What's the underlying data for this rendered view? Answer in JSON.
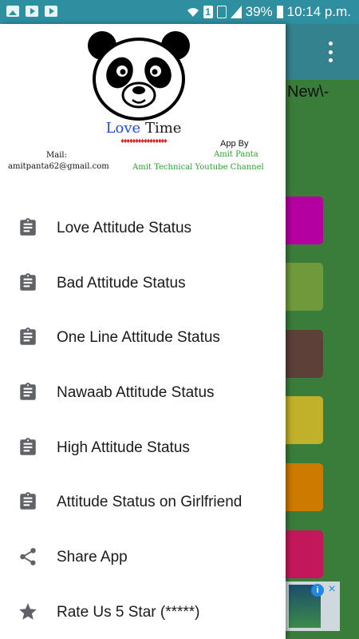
{
  "status_bar": {
    "battery": "39%",
    "sim": "1",
    "time": "10:14 p.m.",
    "icons": [
      "image-icon",
      "video-icon",
      "video-icon",
      "wifi-icon",
      "sim-icon",
      "no-signal-icon",
      "signal-icon",
      "battery-icon"
    ]
  },
  "background_app": {
    "title_fragment": "New\\-",
    "accent": "#35828f",
    "tile_colors": [
      "#b5009f",
      "#6f9a3c",
      "#5d4037",
      "#c0b02a",
      "#cc7a00",
      "#c2185b"
    ]
  },
  "drawer": {
    "logo": {
      "word1": "Love",
      "word2": "Time",
      "hearts": "♦♦♦♦♦♦♦♦♦♦♦♦♦♦♦♦"
    },
    "mail_label": "Mail:",
    "mail_value": "amitpanta62@gmail.com",
    "app_by_label": "App By",
    "app_by_name": "Amit Panta",
    "app_by_channel": "Amit Technical Youtube Channel",
    "items": [
      {
        "label": "Love Attitude Status",
        "icon": "clipboard-icon"
      },
      {
        "label": "Bad Attitude Status",
        "icon": "clipboard-icon"
      },
      {
        "label": "One Line Attitude Status",
        "icon": "clipboard-icon"
      },
      {
        "label": "Nawaab Attitude Status",
        "icon": "clipboard-icon"
      },
      {
        "label": "High Attitude Status",
        "icon": "clipboard-icon"
      },
      {
        "label": "Attitude Status on Girlfriend",
        "icon": "clipboard-icon"
      },
      {
        "label": "Share App",
        "icon": "share-icon"
      },
      {
        "label": "Rate Us 5 Star (*****)",
        "icon": "star-icon"
      }
    ]
  }
}
